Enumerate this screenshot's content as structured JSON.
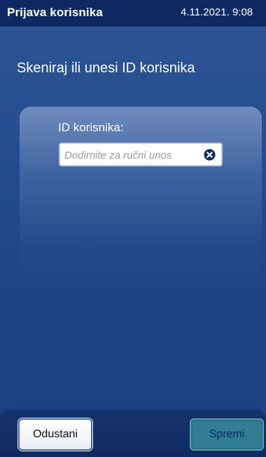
{
  "header": {
    "title": "Prijava korisnika",
    "datetime": "4.11.2021. 9:08"
  },
  "prompt": "Skeniraj ili unesi ID korisnika",
  "form": {
    "id_label": "ID korisnika:",
    "id_value": "",
    "id_placeholder": "Dodirnite za ručni unos"
  },
  "buttons": {
    "cancel": "Odustani",
    "save": "Spremi"
  },
  "colors": {
    "title_bar": "#0d2a64",
    "background": "#264d8f",
    "save_button": "#2f7e92"
  },
  "icons": {
    "clear": "clear-circle-x-icon"
  }
}
